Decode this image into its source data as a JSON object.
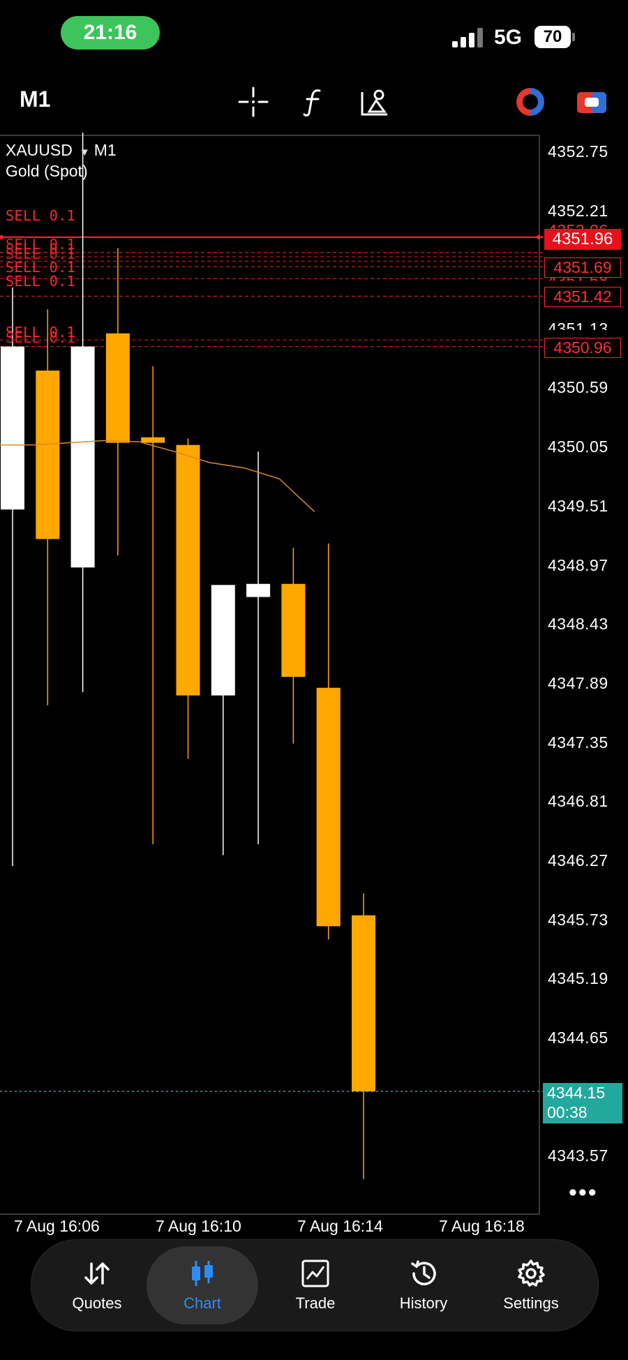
{
  "status_bar": {
    "time": "21:16",
    "network": "5G",
    "battery": "70"
  },
  "toolbar": {
    "timeframe": "M1",
    "icons": [
      "crosshair-icon",
      "indicator-icon",
      "objects-icon",
      "trade-direction-icon",
      "account-icon"
    ]
  },
  "chart": {
    "symbol": "XAUUSD",
    "timeframe": "M1",
    "description": "Gold (Spot)",
    "price_axis": [
      "4352.75",
      "4352.21",
      "4351.13",
      "4350.59",
      "4350.05",
      "4349.51",
      "4348.97",
      "4348.43",
      "4347.89",
      "4347.35",
      "4346.81",
      "4346.27",
      "4345.73",
      "4345.19",
      "4344.65",
      "4343.57"
    ],
    "partial_price_labels": [
      "4352.06",
      "4351.80",
      "4351.58"
    ],
    "orders": [
      {
        "label": "SELL 0.1",
        "price": "4351.96"
      },
      {
        "label": "SELL 0.1",
        "price": "4351.69"
      },
      {
        "label": "SELL 0.1",
        "price": "4351.42"
      },
      {
        "label": "SELL 0.1",
        "price": "4350.96"
      }
    ],
    "current_sell_price": "4351.96",
    "bid_price": "4344.15",
    "countdown": "00:38",
    "time_axis": [
      "7 Aug 16:06",
      "7 Aug 16:10",
      "7 Aug 16:14",
      "7 Aug 16:18"
    ],
    "colors": {
      "bull": "#ffffff",
      "bear": "#ffa800",
      "order_line": "#ff2a2a",
      "bid_line": "#23a89d",
      "moving_average": "#d98a2a"
    }
  },
  "chart_data": {
    "type": "candlestick",
    "ylim": [
      4343.3,
      4353.0
    ],
    "candles": [
      {
        "open": 4349.47,
        "high": 4351.5,
        "low": 4346.21,
        "close": 4350.96
      },
      {
        "open": 4350.74,
        "high": 4351.3,
        "low": 4347.68,
        "close": 4349.2
      },
      {
        "open": 4348.94,
        "high": 4353.0,
        "low": 4347.8,
        "close": 4350.96
      },
      {
        "open": 4351.08,
        "high": 4351.86,
        "low": 4349.05,
        "close": 4350.08
      },
      {
        "open": 4350.13,
        "high": 4350.78,
        "low": 4346.41,
        "close": 4350.08
      },
      {
        "open": 4350.06,
        "high": 4350.12,
        "low": 4347.19,
        "close": 4347.77
      },
      {
        "open": 4347.77,
        "high": 4348.76,
        "low": 4346.31,
        "close": 4348.78
      },
      {
        "open": 4348.67,
        "high": 4350.0,
        "low": 4346.41,
        "close": 4348.79
      },
      {
        "open": 4348.79,
        "high": 4349.12,
        "low": 4347.33,
        "close": 4347.94
      },
      {
        "open": 4347.84,
        "high": 4349.16,
        "low": 4345.54,
        "close": 4345.66
      },
      {
        "open": 4345.76,
        "high": 4345.96,
        "low": 4343.35,
        "close": 4344.15
      }
    ],
    "moving_average": [
      4350.06,
      4350.06,
      4350.08,
      4350.1,
      4350.09,
      4350.0,
      4349.9,
      4349.85,
      4349.75,
      4349.45
    ]
  },
  "bottom_nav": [
    {
      "label": "Quotes",
      "icon": "quotes-icon",
      "active": false
    },
    {
      "label": "Chart",
      "icon": "chart-icon",
      "active": true
    },
    {
      "label": "Trade",
      "icon": "trade-icon",
      "active": false
    },
    {
      "label": "History",
      "icon": "history-icon",
      "active": false
    },
    {
      "label": "Settings",
      "icon": "settings-icon",
      "active": false
    }
  ]
}
